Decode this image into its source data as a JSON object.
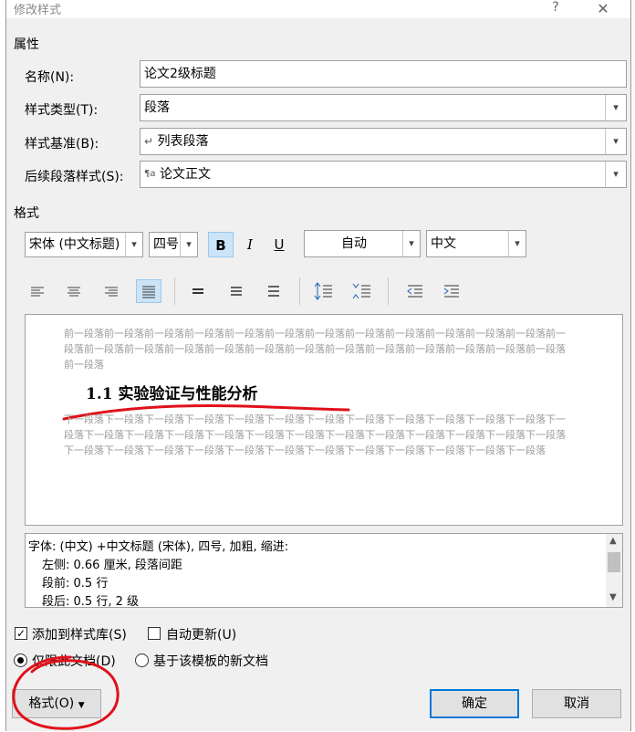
{
  "dialog": {
    "title": "修改样式",
    "help": "?",
    "close": "✕"
  },
  "properties": {
    "section_label": "属性",
    "name_label": "名称(N):",
    "name_value": "论文2级标题",
    "type_label": "样式类型(T):",
    "type_value": "段落",
    "base_label": "样式基准(B):",
    "base_value": "列表段落",
    "next_label": "后续段落样式(S):",
    "next_value": "论文正文"
  },
  "format": {
    "section_label": "格式",
    "font": "宋体 (中文标题)",
    "size": "四号",
    "bold": "B",
    "italic": "I",
    "underline": "U",
    "color": "自动",
    "language": "中文"
  },
  "preview": {
    "prev_para": "前一段落前一段落前一段落前一段落前一段落前一段落前一段落前一段落前一段落前一段落前一段落前一段落前一段落前一段落前一段落前一段落前一段落前一段落前一段落前一段落前一段落前一段落前一段落前一段落前一段落前一段落",
    "heading": "1.1 实验验证与性能分析",
    "next_para": "下一段落下一段落下一段落下一段落下一段落下一段落下一段落下一段落下一段落下一段落下一段落下一段落下一段落下一段落下一段落下一段落下一段落下一段落下一段落下一段落下一段落下一段落下一段落下一段落下一段落下一段落下一段落下一段落下一段落下一段落下一段落下一段落下一段落下一段落下一段落下一段落下一段落"
  },
  "description": {
    "line1": "字体: (中文) +中文标题 (宋体), 四号, 加粗, 缩进:",
    "line2": "左侧:  0.66 厘米, 段落间距",
    "line3": "段前: 0.5 行",
    "line4": "段后: 0.5 行, 2 级"
  },
  "options": {
    "add_to_gallery": "添加到样式库(S)",
    "auto_update": "自动更新(U)",
    "this_doc_only": "仅限此文档(D)",
    "template_docs": "基于该模板的新文档"
  },
  "buttons": {
    "format": "格式(O)",
    "ok": "确定",
    "cancel": "取消"
  },
  "colors": {
    "accent": "#0078d7",
    "annotation": "#e0101a",
    "selected_bg": "#cce4f7"
  }
}
